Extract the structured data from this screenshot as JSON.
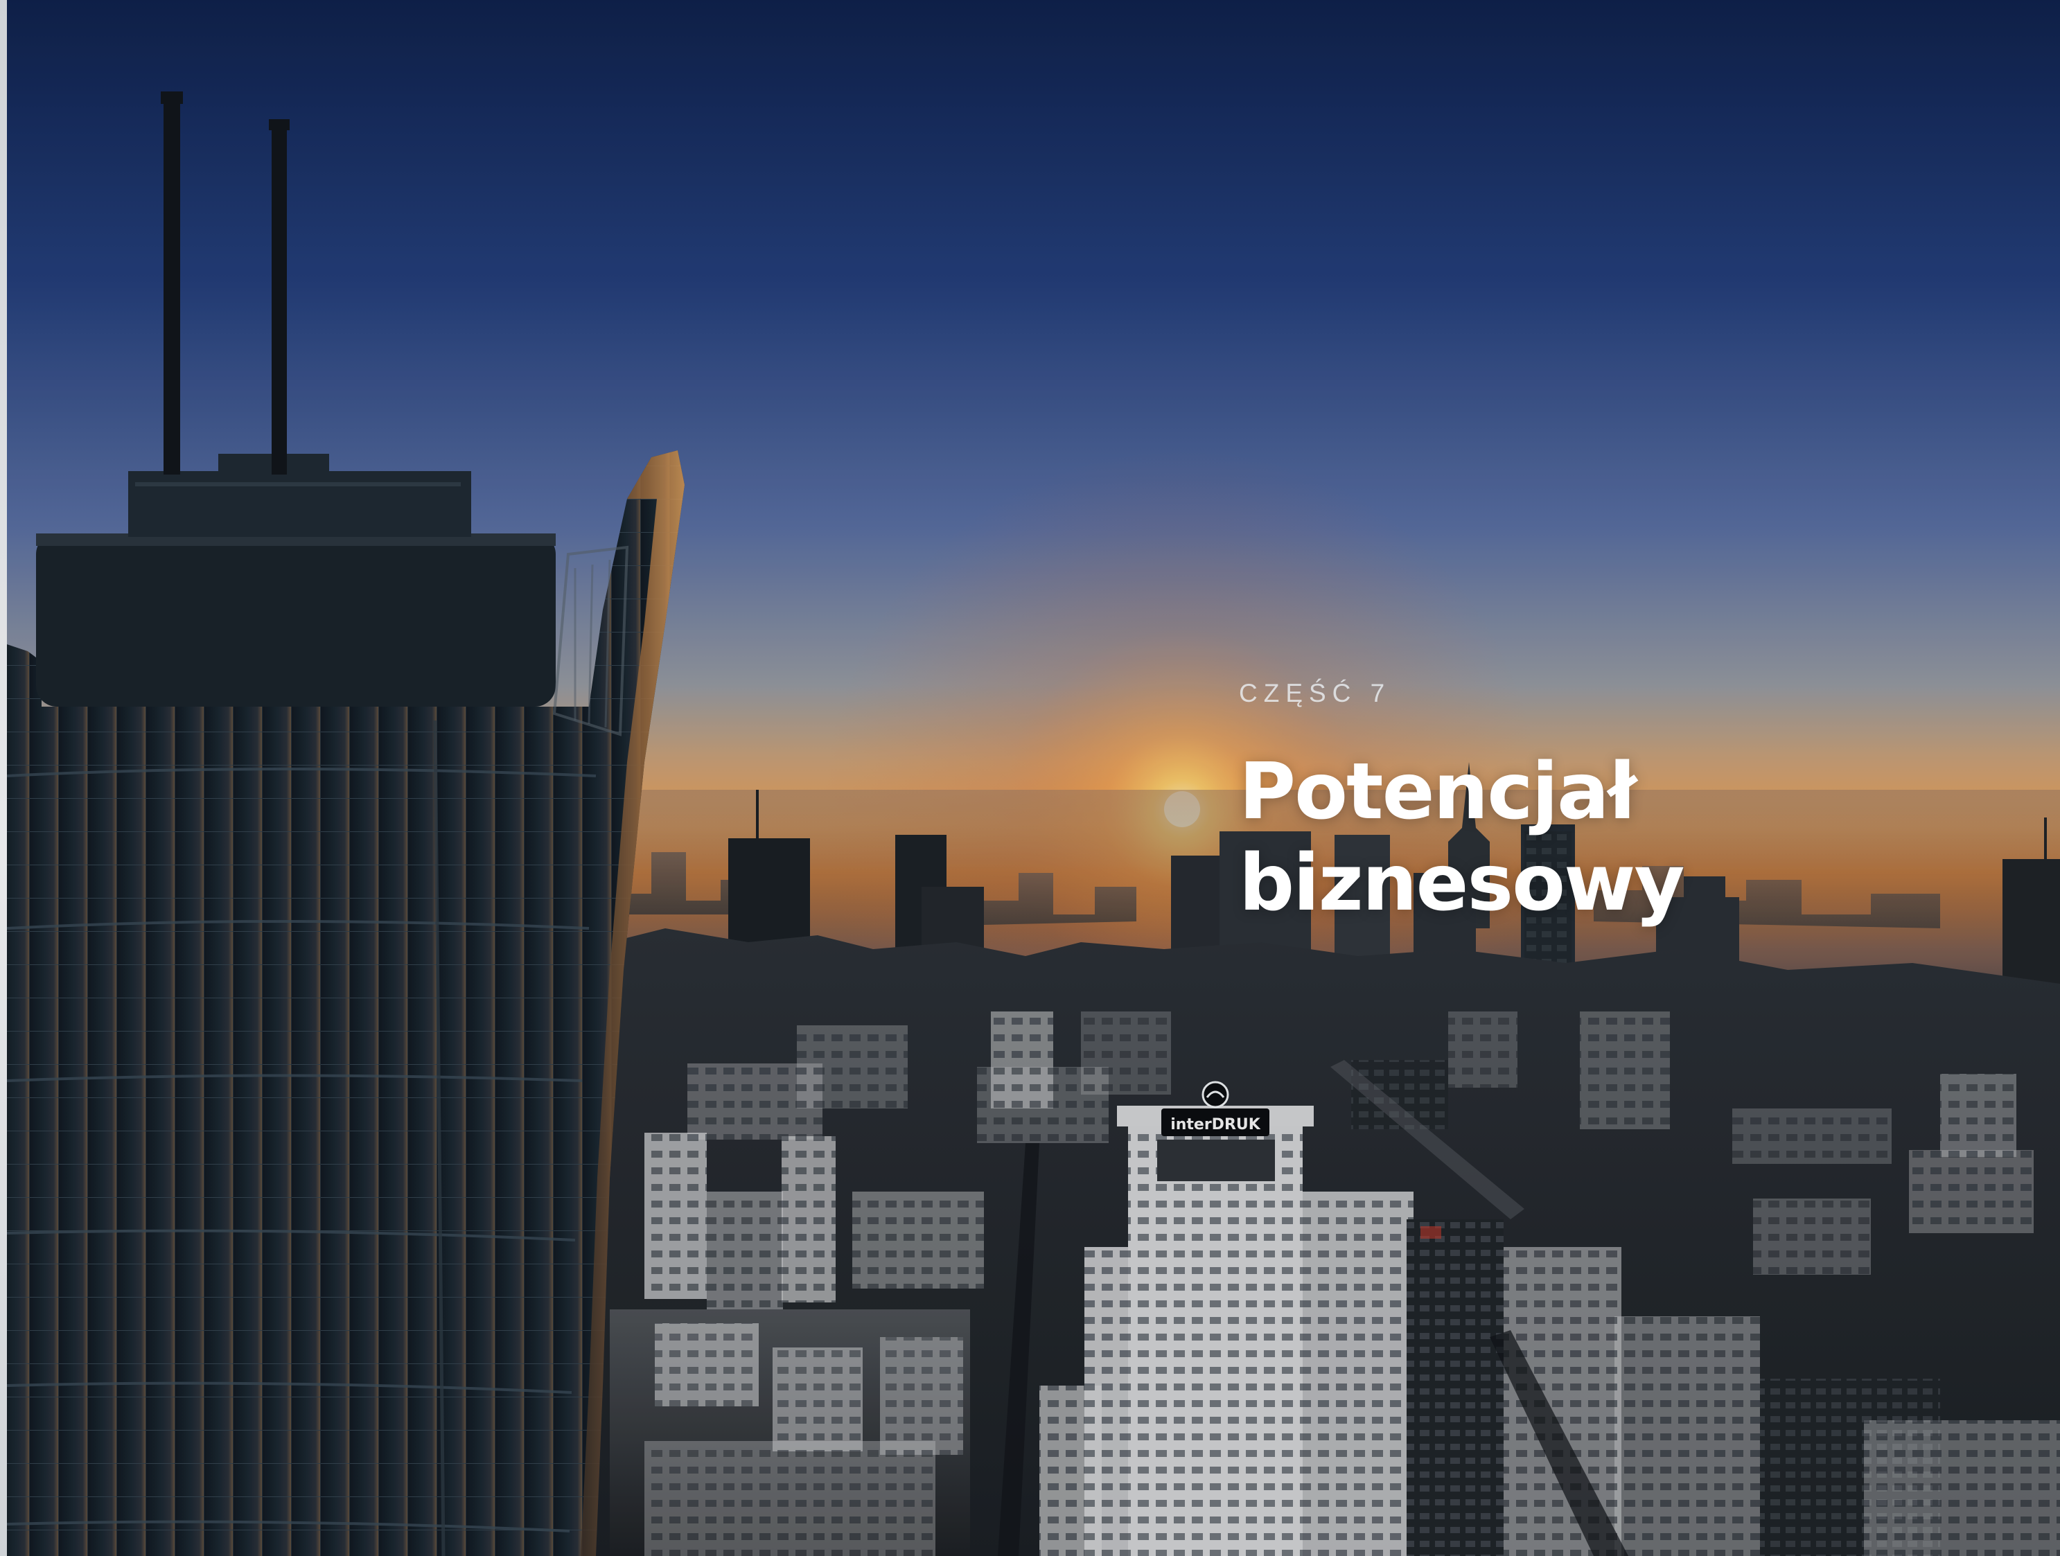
{
  "section": {
    "label": "CZĘŚĆ 7"
  },
  "heading": {
    "line1": "Potencjał",
    "line2": "biznesowy"
  },
  "billboard": {
    "brand": "interDRUK"
  },
  "colors": {
    "sky_top": "#10224d",
    "sky_mid": "#5a6d9d",
    "horizon": "#d7843a",
    "heading_text": "#ffffff",
    "label_text": "#d9dfe6"
  }
}
